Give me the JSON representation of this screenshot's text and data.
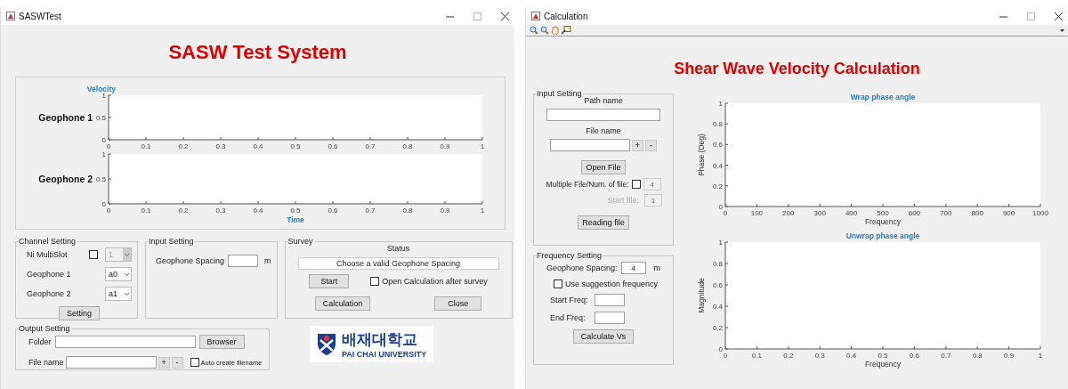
{
  "main_window": {
    "title": "SASWTest",
    "heading": "SASW Test System",
    "charts": [
      {
        "chart_data": {
          "type": "line",
          "title": "Velocity",
          "ylabel": "Geophone 1",
          "xlim": [
            0,
            1
          ],
          "ylim": [
            0,
            1
          ],
          "xticks": [
            0,
            0.1,
            0.2,
            0.3,
            0.4,
            0.5,
            0.6,
            0.7,
            0.8,
            0.9,
            1
          ],
          "yticks": [
            0,
            0.5,
            1
          ]
        }
      },
      {
        "chart_data": {
          "type": "line",
          "ylabel": "Geophone 2",
          "xlabel": "Time",
          "xlim": [
            0,
            1
          ],
          "ylim": [
            0,
            1
          ],
          "xticks": [
            0,
            0.1,
            0.2,
            0.3,
            0.4,
            0.5,
            0.6,
            0.7,
            0.8,
            0.9,
            1
          ],
          "yticks": [
            0,
            0.5,
            1
          ]
        }
      }
    ],
    "channel_setting": {
      "title": "Channel Setting",
      "multislot": {
        "label": "Ni MultiSlot",
        "checked": false,
        "value": "1",
        "disabled": true
      },
      "geophones": [
        {
          "label": "Geophone 1",
          "value": "a0"
        },
        {
          "label": "Geophone 2",
          "value": "a1"
        }
      ],
      "button": "Setting"
    },
    "input_setting": {
      "title": "Input Setting",
      "spacing_label": "Geophone Spacing",
      "unit": "m"
    },
    "survey": {
      "title": "Survey",
      "status_label": "Status",
      "status": "Choose a valid Geophone Spacing",
      "start": "Start",
      "open_calc": {
        "label": "Open Calculation after survey",
        "checked": false
      },
      "calculation": "Calculation",
      "close": "Close"
    },
    "output_setting": {
      "title": "Output Setting",
      "folder_label": "Folder",
      "browse": "Browser",
      "file_label": "File name",
      "plus": "+",
      "minus": "-",
      "auto": {
        "label": "Auto create filename",
        "checked": false
      }
    },
    "logo": {
      "korean": "배재대학교",
      "english": "PAI CHAI UNIVERSITY"
    }
  },
  "calc_window": {
    "title": "Calculation",
    "heading": "Shear Wave Velocity Calculation",
    "input_setting": {
      "title": "Input Setting",
      "path_label": "Path name",
      "file_label": "File name",
      "plus": "+",
      "minus": "-",
      "open": "Open File",
      "multiple": {
        "label": "Multiple File/Num. of file:",
        "checked": false,
        "value": "4",
        "disabled": true
      },
      "start_file": {
        "label": "Start file:",
        "value": "1",
        "disabled": true
      },
      "reading": "Reading file"
    },
    "frequency_setting": {
      "title": "Frequency Setting",
      "spacing_label": "Geophone Spacing:",
      "spacing_value": "4",
      "unit": "m",
      "suggestion": {
        "label": "Use suggestion frequency",
        "checked": false
      },
      "start_label": "Start Freq:",
      "end_label": "End Freq:",
      "calculate": "Calculate Vs"
    },
    "charts": [
      {
        "chart_data": {
          "type": "line",
          "title": "Wrap phase angle",
          "xlabel": "Frequency",
          "ylabel": "Phase (Deg)",
          "xlim": [
            0,
            1000
          ],
          "ylim": [
            0,
            1
          ],
          "xticks": [
            0,
            100,
            200,
            300,
            400,
            500,
            600,
            700,
            800,
            900,
            1000
          ],
          "yticks": [
            0,
            0.2,
            0.4,
            0.6,
            0.8,
            1
          ]
        }
      },
      {
        "chart_data": {
          "type": "line",
          "title": "Unwrap phase angle",
          "xlabel": "Frequency",
          "ylabel": "Magnitude",
          "xlim": [
            0,
            1
          ],
          "ylim": [
            0,
            1
          ],
          "xticks": [
            0,
            0.1,
            0.2,
            0.3,
            0.4,
            0.5,
            0.6,
            0.7,
            0.8,
            0.9,
            1
          ],
          "yticks": [
            0,
            0.2,
            0.4,
            0.6,
            0.8,
            1
          ]
        }
      }
    ]
  }
}
